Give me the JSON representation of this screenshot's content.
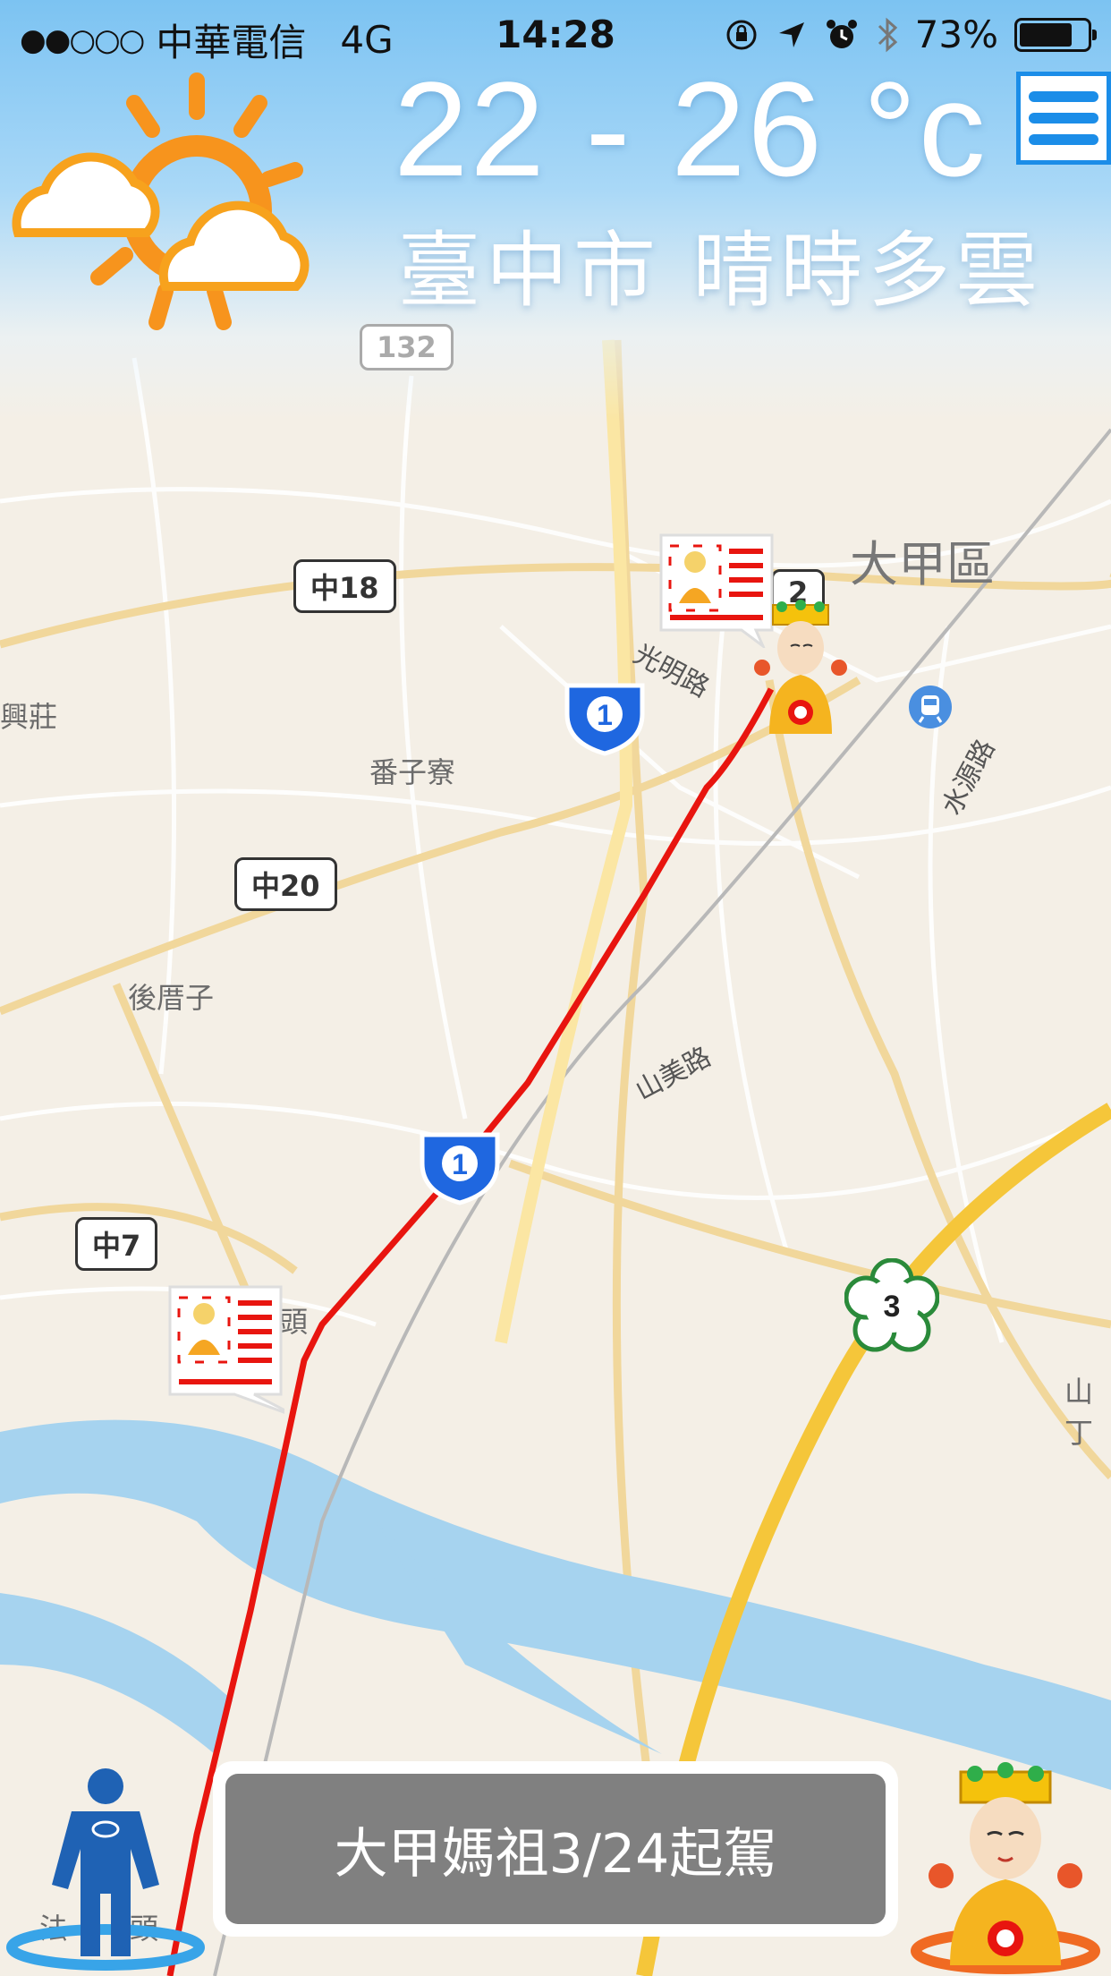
{
  "status_bar": {
    "signal": "●●○○○",
    "carrier": "中華電信",
    "network": "4G",
    "time": "14:28",
    "battery_percent": "73%",
    "icons": [
      "orientation-lock-icon",
      "location-arrow-icon",
      "alarm-icon",
      "bluetooth-icon",
      "battery-icon"
    ]
  },
  "weather": {
    "temperature": "22 - 26 °c",
    "condition": "臺中市 晴時多雲",
    "icon": "sun-cloud-icon"
  },
  "map": {
    "district_label": "大甲區",
    "places": [
      "番子寮",
      "後厝子",
      "興莊",
      "頭",
      "法",
      "頭",
      "山丁"
    ],
    "roads": [
      "光明路",
      "水源路",
      "山美路"
    ],
    "shields": [
      "中18",
      "中20",
      "中7",
      "132",
      "1",
      "1",
      "3",
      "2"
    ],
    "route_color": "#e8150f",
    "highway_color": "#f5c63a"
  },
  "menu": {
    "icon": "hamburger-menu-icon"
  },
  "notice": {
    "text": "大甲媽祖3/24起駕"
  },
  "colors": {
    "sky": "#7cc3f2",
    "accent": "#1b8de8",
    "notice_bg": "#808080"
  }
}
